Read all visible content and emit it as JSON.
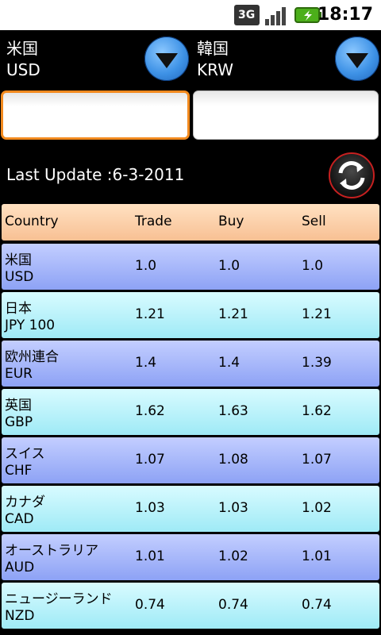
{
  "status_bar": {
    "network": "3G",
    "time": "18:17"
  },
  "from_currency": {
    "name": "米国",
    "code": "USD"
  },
  "to_currency": {
    "name": "韓国",
    "code": "KRW"
  },
  "inputs": {
    "from_value": "",
    "to_value": ""
  },
  "last_update": "Last Update :6-3-2011",
  "table": {
    "headers": {
      "country": "Country",
      "trade": "Trade",
      "buy": "Buy",
      "sell": "Sell"
    },
    "rows": [
      {
        "name": "米国",
        "code": "USD",
        "trade": "1.0",
        "buy": "1.0",
        "sell": "1.0"
      },
      {
        "name": "日本",
        "code": "JPY 100",
        "trade": "1.21",
        "buy": "1.21",
        "sell": "1.21"
      },
      {
        "name": "欧州連合",
        "code": "EUR",
        "trade": "1.4",
        "buy": "1.4",
        "sell": "1.39"
      },
      {
        "name": "英国",
        "code": "GBP",
        "trade": "1.62",
        "buy": "1.63",
        "sell": "1.62"
      },
      {
        "name": "スイス",
        "code": "CHF",
        "trade": "1.07",
        "buy": "1.08",
        "sell": "1.07"
      },
      {
        "name": "カナダ",
        "code": "CAD",
        "trade": "1.03",
        "buy": "1.03",
        "sell": "1.02"
      },
      {
        "name": "オーストラリア",
        "code": "AUD",
        "trade": "1.01",
        "buy": "1.02",
        "sell": "1.01"
      },
      {
        "name": "ニュージーランド",
        "code": "NZD",
        "trade": "0.74",
        "buy": "0.74",
        "sell": "0.74"
      }
    ]
  },
  "colors": {
    "row_blue": "#a9b8f8",
    "row_cyan": "#bdf4fb",
    "header_orange": "#f9c89c",
    "focus_border": "#f28a1e"
  }
}
